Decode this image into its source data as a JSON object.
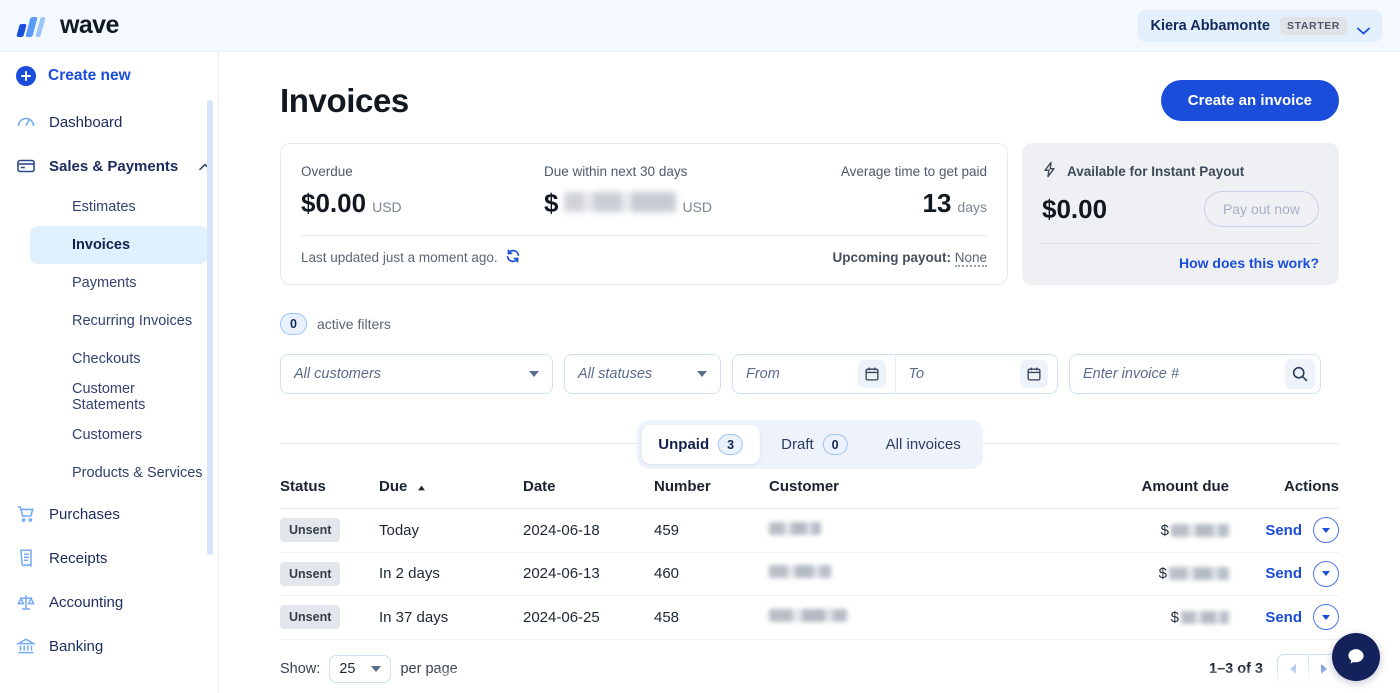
{
  "brand": {
    "name": "wave",
    "accent": "#1b4ddb",
    "logo_icon": "wave-logo-icon"
  },
  "topbar": {
    "user_name": "Kiera Abbamonte",
    "plan_badge": "STARTER"
  },
  "sidebar": {
    "create_new_label": "Create new",
    "items": [
      {
        "label": "Dashboard",
        "icon": "dashboard-icon",
        "type": "top"
      },
      {
        "label": "Sales & Payments",
        "icon": "card-icon",
        "type": "top",
        "expanded": true
      },
      {
        "label": "Estimates",
        "type": "sub"
      },
      {
        "label": "Invoices",
        "type": "sub",
        "active": true
      },
      {
        "label": "Payments",
        "type": "sub"
      },
      {
        "label": "Recurring Invoices",
        "type": "sub"
      },
      {
        "label": "Checkouts",
        "type": "sub"
      },
      {
        "label": "Customer Statements",
        "type": "sub"
      },
      {
        "label": "Customers",
        "type": "sub"
      },
      {
        "label": "Products & Services",
        "type": "sub"
      },
      {
        "label": "Purchases",
        "icon": "cart-icon",
        "type": "top"
      },
      {
        "label": "Receipts",
        "icon": "receipt-icon",
        "type": "top"
      },
      {
        "label": "Accounting",
        "icon": "scales-icon",
        "type": "top"
      },
      {
        "label": "Banking",
        "icon": "bank-icon",
        "type": "top"
      }
    ]
  },
  "page": {
    "title": "Invoices",
    "create_invoice_label": "Create an invoice"
  },
  "summary": {
    "overdue_label": "Overdue",
    "overdue_value": "$0.00",
    "overdue_currency": "USD",
    "due30_label": "Due within next 30 days",
    "due30_prefix": "$",
    "due30_value_hidden": true,
    "due30_currency": "USD",
    "avgtime_label": "Average time to get paid",
    "avgtime_value": "13",
    "avgtime_unit": "days",
    "last_updated": "Last updated just a moment ago.",
    "refresh_icon": "refresh-icon",
    "upcoming_payout_label": "Upcoming payout:",
    "upcoming_payout_value": "None"
  },
  "payout_card": {
    "icon": "lightning-icon",
    "title": "Available for Instant Payout",
    "amount": "$0.00",
    "button_label": "Pay out now",
    "link_label": "How does this work?"
  },
  "filters": {
    "active_count": "0",
    "active_label": "active filters",
    "customers_value": "All customers",
    "statuses_value": "All statuses",
    "from_placeholder": "From",
    "to_placeholder": "To",
    "invoice_search_placeholder": "Enter invoice #",
    "invoice_search_value": "",
    "calendar_icon": "calendar-icon",
    "search_icon": "search-icon"
  },
  "tabs": [
    {
      "label": "Unpaid",
      "count": "3",
      "active": true
    },
    {
      "label": "Draft",
      "count": "0",
      "active": false
    },
    {
      "label": "All invoices",
      "count": null,
      "active": false
    }
  ],
  "table": {
    "columns": [
      "Status",
      "Due",
      "Date",
      "Number",
      "Customer",
      "Amount due",
      "Actions"
    ],
    "sort_column": "Due",
    "sort_direction": "asc",
    "sort_icon": "caret-up-icon",
    "rows": [
      {
        "status": "Unsent",
        "due": "Today",
        "date": "2024-06-18",
        "number": "459",
        "customer_hidden": true,
        "amount_prefix": "$",
        "amount_hidden": true,
        "action": "Send",
        "action_menu_icon": "caret-down-icon"
      },
      {
        "status": "Unsent",
        "due": "In 2 days",
        "date": "2024-06-13",
        "number": "460",
        "customer_hidden": true,
        "amount_prefix": "$",
        "amount_hidden": true,
        "action": "Send",
        "action_menu_icon": "caret-down-icon"
      },
      {
        "status": "Unsent",
        "due": "In 37 days",
        "date": "2024-06-25",
        "number": "458",
        "customer_hidden": true,
        "amount_prefix": "$",
        "amount_hidden": true,
        "action": "Send",
        "action_menu_icon": "caret-down-icon"
      }
    ]
  },
  "footer": {
    "show_label": "Show:",
    "per_page_value": "25",
    "per_page_label": "per page",
    "range_label": "1–3 of 3",
    "prev_icon": "caret-left-icon",
    "next_icon": "caret-right-icon"
  },
  "chat": {
    "icon": "chat-bubble-icon"
  }
}
